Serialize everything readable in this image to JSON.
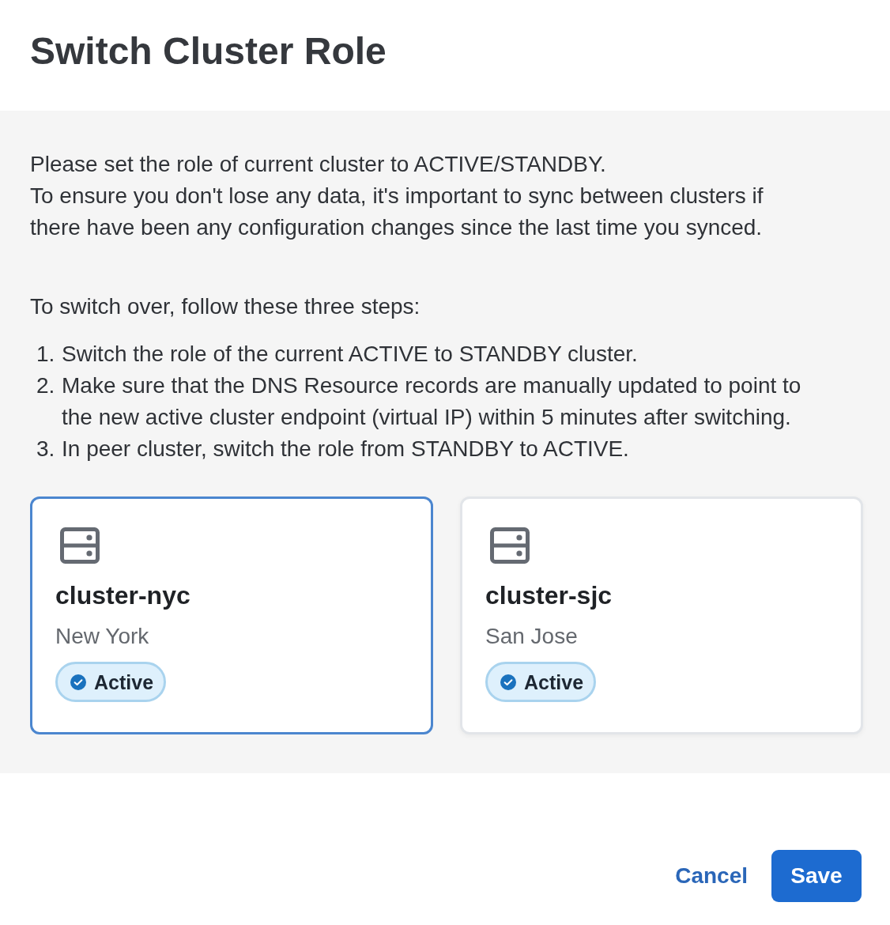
{
  "dialog": {
    "title": "Switch Cluster Role"
  },
  "intro": [
    "Please set the role of current cluster to ACTIVE/STANDBY.",
    "To ensure you don't lose any data, it's important to sync between clusters if there have been any configuration changes since the last time you synced."
  ],
  "steps_heading": "To switch over, follow these three steps:",
  "steps": [
    {
      "number": "1.",
      "text": "Switch the role of the current ACTIVE to STANDBY cluster."
    },
    {
      "number": "2.",
      "text": "Make sure that the DNS Resource records are manually updated to point to the new active cluster endpoint (virtual IP) within 5 minutes after switching."
    },
    {
      "number": "3.",
      "text": "In peer cluster, switch the role from STANDBY to ACTIVE."
    }
  ],
  "clusters": [
    {
      "name": "cluster-nyc",
      "location": "New York",
      "status": "Active",
      "selected": true
    },
    {
      "name": "cluster-sjc",
      "location": "San Jose",
      "status": "Active",
      "selected": false
    }
  ],
  "buttons": [
    {
      "kind": "link",
      "label": "Cancel"
    },
    {
      "kind": "primary",
      "label": "Save"
    }
  ]
}
